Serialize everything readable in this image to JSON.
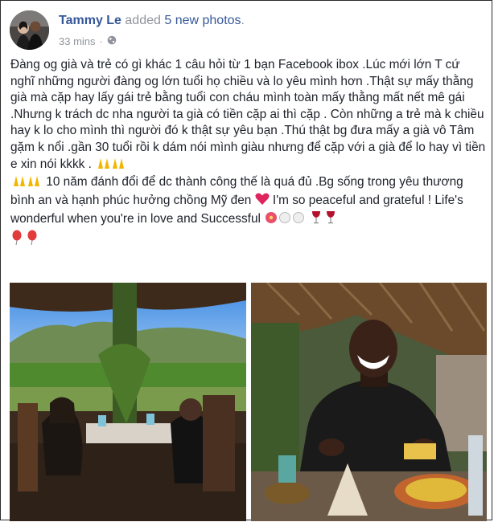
{
  "post": {
    "author": "Tammy Le",
    "action_prefix": "added",
    "action_link": "5 new photos",
    "action_suffix": ".",
    "time": "33 mins",
    "separator": "·",
    "privacy_icon": "globe-icon",
    "text_1": "Đàng og già và trẻ có gì khác 1 câu hỏi từ 1 bạn Facebook ibox .Lúc mới lớn T cứ nghĩ những người đàng og lớn tuổi họ chiều và lo yêu mình hơn .Thật sự mấy thằng già mà cặp hay lấy gái trẻ bằng tuổi con cháu mình toàn mấy thằng mất nết mê gái .Nhưng k trách dc nha người ta già có tiền cặp ai thì cặp . Còn những a trẻ mà k chiều hay k lo cho mình thì người đó k thật sự yêu bạn .Thú thật bg đưa mấy a già vô Tâm gặm k nổi .gần 30 tuổi rồi k dám nói mình giàu nhưng để cặp với a già để lo hay vì tiền e xin nói kkkk .",
    "text_2": "10 năm đánh đổi để dc thành công thế là quá đủ .Bg sống trong yêu thương bình an và hạnh phúc hưởng chồng Mỹ đen",
    "text_3": "I'm so peaceful and grateful ! Life's wonderful when you're in love and Successful",
    "emoji_icons": [
      "praying-hands-icon",
      "red-heart-icon",
      "hibiscus-icon",
      "plate-icon",
      "wine-glass-icon",
      "balloon-icon"
    ]
  },
  "colors": {
    "link": "#365899",
    "meta": "#90949c",
    "text": "#1d2129",
    "heart": "#e0245e"
  }
}
